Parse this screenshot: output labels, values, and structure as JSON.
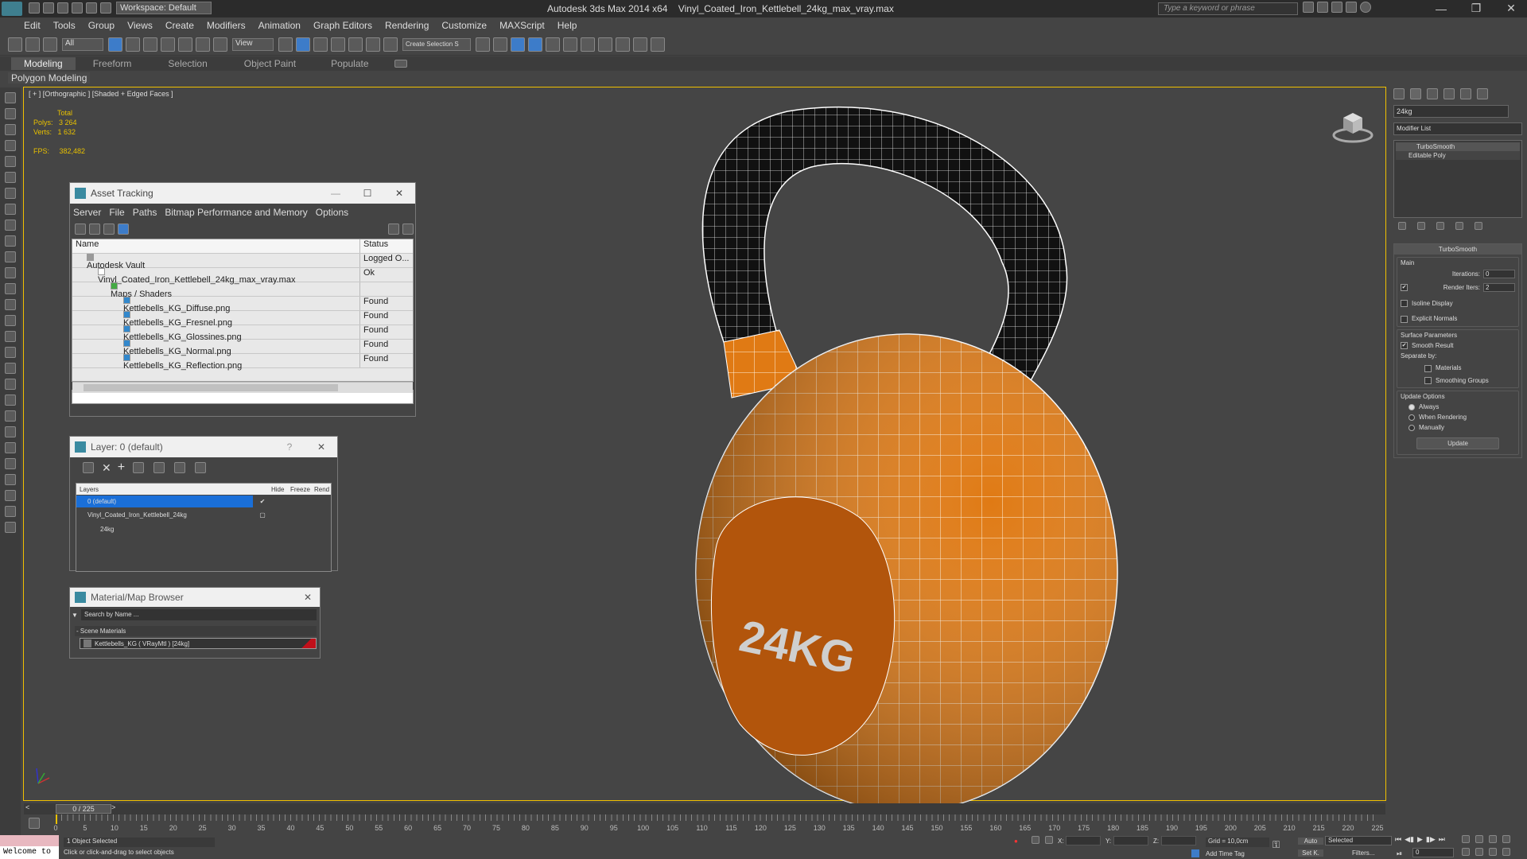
{
  "app": {
    "title": "Autodesk 3ds Max  2014 x64",
    "file": "Vinyl_Coated_Iron_Kettlebell_24kg_max_vray.max",
    "workspace": "Workspace: Default",
    "search_placeholder": "Type a keyword or phrase"
  },
  "menu": [
    "Edit",
    "Tools",
    "Group",
    "Views",
    "Create",
    "Modifiers",
    "Animation",
    "Graph Editors",
    "Rendering",
    "Customize",
    "MAXScript",
    "Help"
  ],
  "toolbar": {
    "filter": "All",
    "view": "View",
    "named_selection": "Create Selection S"
  },
  "ribbon": {
    "tabs": [
      "Modeling",
      "Freeform",
      "Selection",
      "Object Paint",
      "Populate"
    ],
    "sub": "Polygon Modeling"
  },
  "viewport": {
    "label": "[ + ] [Orthographic ] [Shaded + Edged Faces ]",
    "stats": {
      "total": "Total",
      "polys_label": "Polys:",
      "polys": "3 264",
      "verts_label": "Verts:",
      "verts": "1 632",
      "fps_label": "FPS:",
      "fps": "382,482"
    },
    "model_text": "24KG",
    "colors": {
      "body": "#e07a14",
      "handle": "#111111",
      "wire": "#ffffff"
    }
  },
  "asset_tracking": {
    "title": "Asset Tracking",
    "menu": [
      "Server",
      "File",
      "Paths",
      "Bitmap Performance and Memory",
      "Options"
    ],
    "col_name": "Name",
    "col_status": "Status",
    "rows": [
      {
        "name": "Autodesk Vault",
        "status": "Logged O..."
      },
      {
        "name": "Vinyl_Coated_Iron_Kettlebell_24kg_max_vray.max",
        "status": "Ok"
      },
      {
        "name": "Maps / Shaders",
        "status": ""
      },
      {
        "name": "Kettlebells_KG_Diffuse.png",
        "status": "Found"
      },
      {
        "name": "Kettlebells_KG_Fresnel.png",
        "status": "Found"
      },
      {
        "name": "Kettlebells_KG_Glossines.png",
        "status": "Found"
      },
      {
        "name": "Kettlebells_KG_Normal.png",
        "status": "Found"
      },
      {
        "name": "Kettlebells_KG_Reflection.png",
        "status": "Found"
      }
    ]
  },
  "layer_dialog": {
    "title": "Layer: 0 (default)",
    "help": "?",
    "cols": [
      "Layers",
      "Hide",
      "Freeze",
      "Rend"
    ],
    "rows": [
      {
        "name": "0 (default)",
        "selected": true
      },
      {
        "name": "Vinyl_Coated_Iron_Kettlebell_24kg",
        "selected": false
      },
      {
        "name": "24kg",
        "selected": false
      }
    ]
  },
  "material_browser": {
    "title": "Material/Map Browser",
    "search": "Search by Name ...",
    "group": "- Scene Materials",
    "item": "Kettlebells_KG  ( VRayMtl ) [24kg]"
  },
  "command_panel": {
    "object_name": "24kg",
    "modifier_list": "Modifier List",
    "stack": [
      "TurboSmooth",
      "Editable Poly"
    ],
    "rollout": {
      "title": "TurboSmooth",
      "main": "Main",
      "iterations_label": "Iterations:",
      "iterations": "0",
      "render_iters_label": "Render Iters:",
      "render_iters": "2",
      "isoline": "Isoline Display",
      "explicit": "Explicit Normals",
      "surface": "Surface Parameters",
      "smooth_result": "Smooth Result",
      "separate": "Separate by:",
      "materials": "Materials",
      "smoothing": "Smoothing Groups",
      "update_opts": "Update Options",
      "always": "Always",
      "when_rendering": "When Rendering",
      "manually": "Manually",
      "update": "Update"
    }
  },
  "timeline": {
    "frame": "0 / 225",
    "ticks": [
      "0",
      "5",
      "10",
      "15",
      "20",
      "25",
      "30",
      "35",
      "40",
      "45",
      "50",
      "55",
      "60",
      "65",
      "70",
      "75",
      "80",
      "85",
      "90",
      "95",
      "100",
      "105",
      "110",
      "115",
      "120",
      "125",
      "130",
      "135",
      "140",
      "145",
      "150",
      "155",
      "160",
      "165",
      "170",
      "175",
      "180",
      "185",
      "190",
      "195",
      "200",
      "205",
      "210",
      "215",
      "220",
      "225"
    ]
  },
  "status": {
    "listener": "Welcome to",
    "selected": "1 Object Selected",
    "prompt": "Click or click-and-drag to select objects",
    "x": "X:",
    "y": "Y:",
    "z": "Z:",
    "grid": "Grid = 10,0cm",
    "auto": "Auto",
    "selected_dd": "Selected",
    "setk": "Set K.",
    "filters": "Filters...",
    "add_time_tag": "Add Time Tag",
    "frame_num": "0"
  }
}
